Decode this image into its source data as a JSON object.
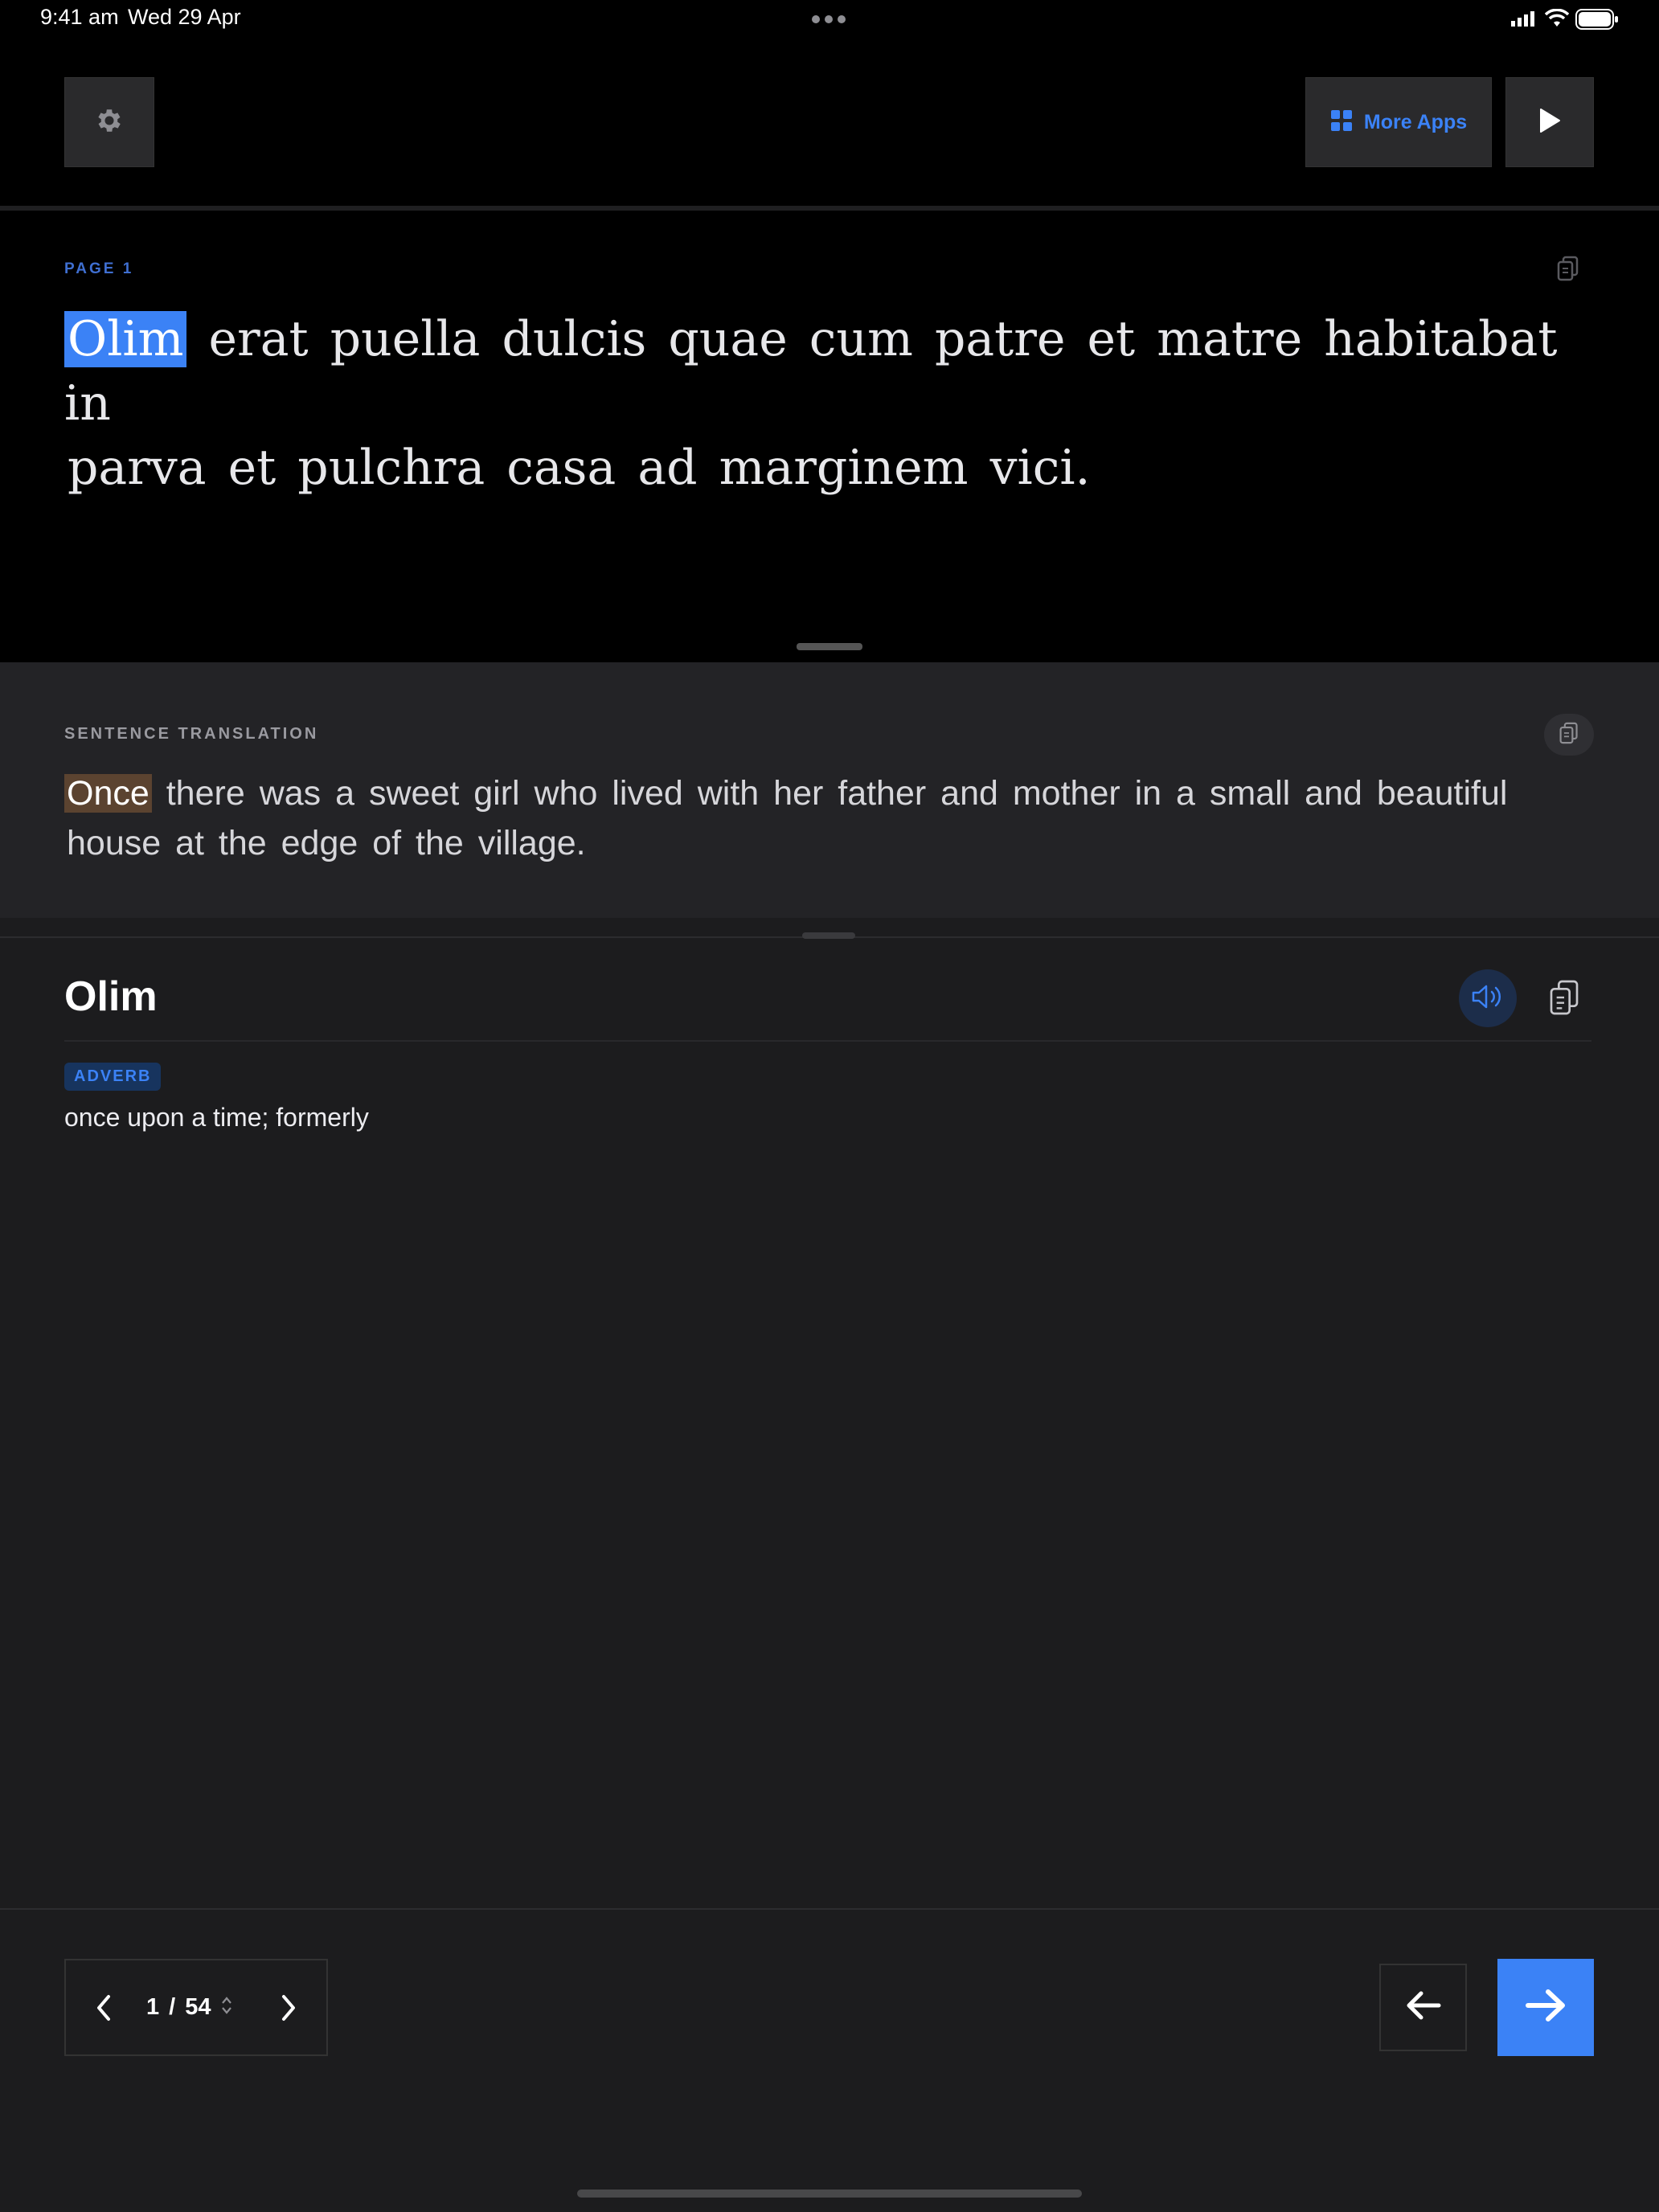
{
  "status_bar": {
    "time": "9:41 am",
    "date": "Wed 29 Apr"
  },
  "toolbar": {
    "more_apps_label": "More Apps",
    "accent_color": "#3b82f6"
  },
  "reader": {
    "page_label": "PAGE 1",
    "highlighted_word": "Olim",
    "sentence_rest_line1": "erat puella dulcis quae cum patre et matre habitabat in",
    "sentence_line2": "parva et pulchra casa ad marginem vici."
  },
  "translation": {
    "section_label": "SENTENCE TRANSLATION",
    "highlighted_word": "Once",
    "sentence_rest_line1": "there was a sweet girl who lived with her father and mother in a small and beautiful",
    "sentence_line2": "house at the edge of the village."
  },
  "dictionary": {
    "headword": "Olim",
    "part_of_speech": "ADVERB",
    "definition": "once upon a time; formerly"
  },
  "pagination": {
    "current_page": "1",
    "separator": "/",
    "total_pages": "54"
  },
  "icons": {
    "settings": "gear-icon",
    "more_apps": "grid-icon",
    "play": "play-icon",
    "copy": "copy-icon",
    "speaker": "speaker-icon",
    "prev_page": "chevron-left-icon",
    "next_page": "chevron-right-icon",
    "back": "arrow-left-icon",
    "forward": "arrow-right-icon"
  }
}
